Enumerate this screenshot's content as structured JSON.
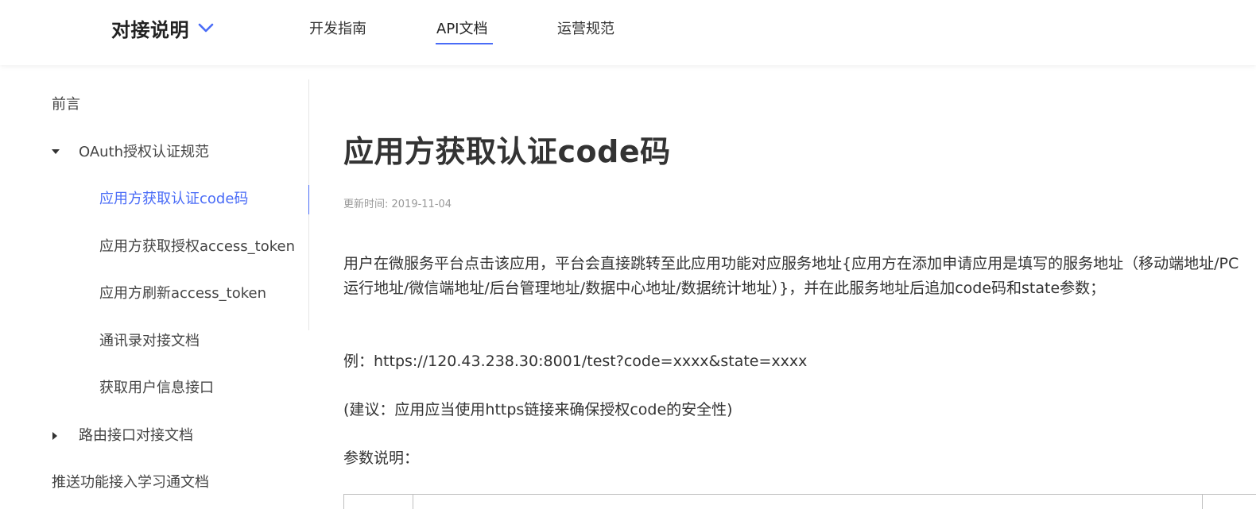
{
  "header": {
    "brand_title": "对接说明",
    "tabs": [
      {
        "label": "开发指南"
      },
      {
        "label": "API文档"
      },
      {
        "label": "运营规范"
      }
    ],
    "active_tab": "API文档",
    "accent_color": "#4a6cf7"
  },
  "sidebar": {
    "items": [
      {
        "label": "前言",
        "level": 0
      },
      {
        "label": "OAuth授权认证规范",
        "level": 0,
        "expanded": true
      },
      {
        "label": "应用方获取认证code码",
        "level": 1,
        "active": true
      },
      {
        "label": "应用方获取授权access_token",
        "level": 1
      },
      {
        "label": "应用方刷新access_token",
        "level": 1
      },
      {
        "label": "通讯录对接文档",
        "level": 1
      },
      {
        "label": "获取用户信息接口",
        "level": 1
      },
      {
        "label": "路由接口对接文档",
        "level": 0,
        "expanded": false
      },
      {
        "label": "推送功能接入学习通文档",
        "level": 0
      }
    ]
  },
  "main": {
    "title": "应用方获取认证code码",
    "updated": "更新时间: 2019-11-04",
    "paragraphs": [
      "用户在微服务平台点击该应用，平台会直接跳转至此应用功能对应服务地址{应用方在添加申请应用是填写的服务地址（移动端地址/PC运行地址/微信端地址/后台管理地址/数据中心地址/数据统计地址）}，并在此服务地址后追加code码和state参数；",
      "例：https://120.43.238.30:8001/test?code=xxxx&state=xxxx",
      "(建议：应用应当使用https链接来确保授权code的安全性)",
      "参数说明："
    ]
  }
}
